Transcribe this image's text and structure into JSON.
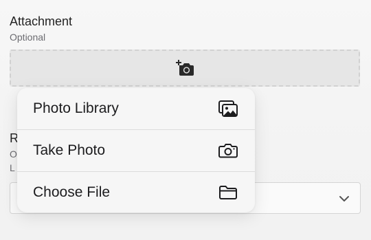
{
  "attachment": {
    "title": "Attachment",
    "subtitle": "Optional",
    "dropzone_icon": "camera-plus-icon"
  },
  "second_field": {
    "title_fragment": "R",
    "subtitle_fragment": "O",
    "hint_fragment": "L",
    "select_icon": "chevron-down-icon"
  },
  "menu": {
    "items": [
      {
        "label": "Photo Library",
        "icon": "photo-library-icon"
      },
      {
        "label": "Take Photo",
        "icon": "camera-icon"
      },
      {
        "label": "Choose File",
        "icon": "folder-icon"
      }
    ]
  },
  "colors": {
    "background": "#f2f2f2",
    "dropzone_fill": "#e6e6e6",
    "dropzone_border": "#d1d1d1",
    "menu_background": "#f6f6f6",
    "text_primary": "#1c1c1e",
    "text_secondary": "#6b6b70"
  }
}
